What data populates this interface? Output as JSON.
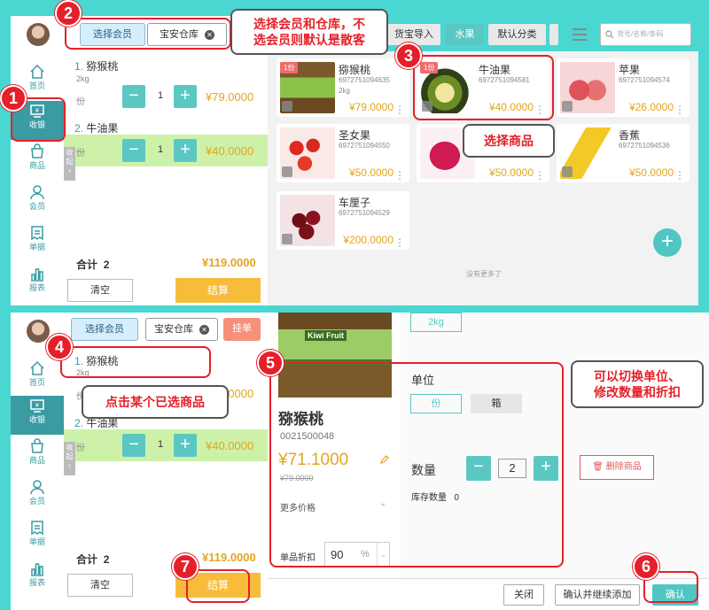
{
  "sidebar": {
    "items": [
      {
        "label": "首页",
        "icon": "home-icon"
      },
      {
        "label": "收银",
        "icon": "cashier-icon"
      },
      {
        "label": "商品",
        "icon": "goods-icon"
      },
      {
        "label": "会员",
        "icon": "member-icon"
      },
      {
        "label": "单据",
        "icon": "receipt-icon"
      },
      {
        "label": "报表",
        "icon": "report-icon"
      }
    ]
  },
  "top": {
    "member_btn": "选择会员",
    "warehouse": "宝安仓库",
    "hold": "挂单"
  },
  "cart": {
    "items": [
      {
        "no": "1.",
        "name": "猕猴桃",
        "spec": "2kg",
        "unit": "份",
        "qty": "1",
        "price": "¥79.0000"
      },
      {
        "no": "2.",
        "name": "牛油果",
        "unit": "份",
        "qty": "1",
        "price": "¥40.0000"
      }
    ],
    "collapse": "收起",
    "total_label": "合计",
    "total_qty": "2",
    "total_amount": "¥119.0000",
    "clear": "清空",
    "checkout": "结算"
  },
  "categories": {
    "partial": "货宝导入",
    "fruit": "水果",
    "default": "默认分类"
  },
  "search": {
    "placeholder": "货号/名称/条码"
  },
  "goods": [
    {
      "name": "猕猴桃",
      "code": "6972751094635",
      "spec": "2kg",
      "price": "¥79.0000",
      "badge": "1份"
    },
    {
      "name": "牛油果",
      "code": "6972751094581",
      "price": "¥40.0000",
      "badge": "1份"
    },
    {
      "name": "苹果",
      "code": "6972751094574",
      "price": "¥26.0000"
    },
    {
      "name": "圣女果",
      "code": "6972751094550",
      "price": "¥50.0000"
    },
    {
      "name": "",
      "code": "",
      "price": "¥50.0000"
    },
    {
      "name": "香蕉",
      "code": "6972751094536",
      "price": "¥50.0000"
    },
    {
      "name": "车厘子",
      "code": "6972751094529",
      "price": "¥200.0000"
    }
  ],
  "no_more": "没有更多了",
  "annotations": {
    "n1": "1",
    "n2": "2",
    "n3": "3",
    "n4": "4",
    "n5": "5",
    "n6": "6",
    "n7": "7",
    "c2a": "选择会员和仓库，不",
    "c2b": "选会员则默认是散客",
    "c3": "选择商品",
    "c4": "点击某个已选商品",
    "c5a": "可以切换单位、",
    "c5b": "修改数量和折扣"
  },
  "detail": {
    "spec": "2kg",
    "product_label": "Kiwi Fruit",
    "name": "猕猴桃",
    "code": "0021500048",
    "price": "¥71.1000",
    "orig_price": "¥79.0000",
    "more_price": "更多价格",
    "discount_label": "单品折扣",
    "discount": "90",
    "discount_unit": "%",
    "unit_label": "单位",
    "unit_a": "份",
    "unit_b": "箱",
    "qty_label": "数量",
    "qty": "2",
    "stock_label": "库存数量",
    "stock": "0",
    "delete": "删除商品"
  },
  "bottom": {
    "close": "关闭",
    "confirm_continue": "确认并继续添加",
    "confirm": "确认"
  }
}
